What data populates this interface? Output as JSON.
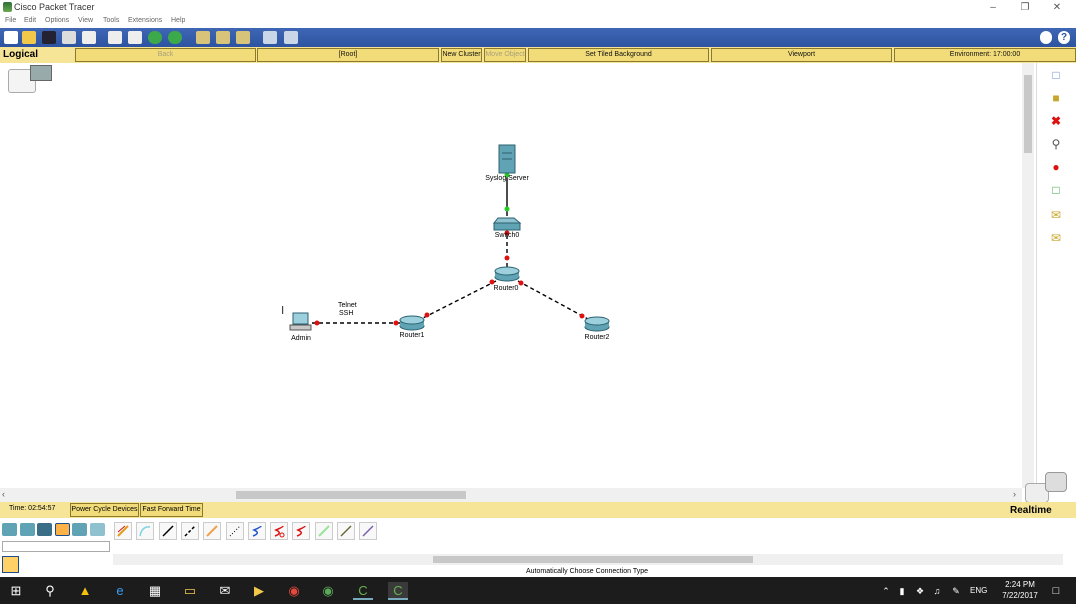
{
  "window": {
    "title": "Cisco Packet Tracer"
  },
  "menu": [
    "File",
    "Edit",
    "Options",
    "View",
    "Tools",
    "Extensions",
    "Help"
  ],
  "nav": {
    "mode": "Logical",
    "back": "Back",
    "root": "[Root]",
    "new_cluster": "New Cluster",
    "move_object": "Move Object",
    "set_tiled_background": "Set Tiled Background",
    "viewport": "Viewport",
    "environment": "Environment: 17:00:00"
  },
  "topology": {
    "devices": {
      "syslog_server": "Syslog Server",
      "switch0": "Switch0",
      "router0": "Router0",
      "router1": "Router1",
      "router2": "Router2",
      "admin": "Admin"
    },
    "link_note_1": "Telnet",
    "link_note_2": "SSH",
    "colors": {
      "link_up": "#22cc22",
      "link_down": "#dd1111"
    }
  },
  "status": {
    "time": "Time: 02:54:57",
    "power_cycle": "Power Cycle Devices",
    "fast_forward": "Fast Forward Time",
    "mode": "Realtime"
  },
  "bottom": {
    "connection_label": "Automatically Choose Connection Type"
  },
  "taskbar": {
    "lang": "ENG",
    "time": "2:24 PM",
    "date": "7/22/2017"
  }
}
